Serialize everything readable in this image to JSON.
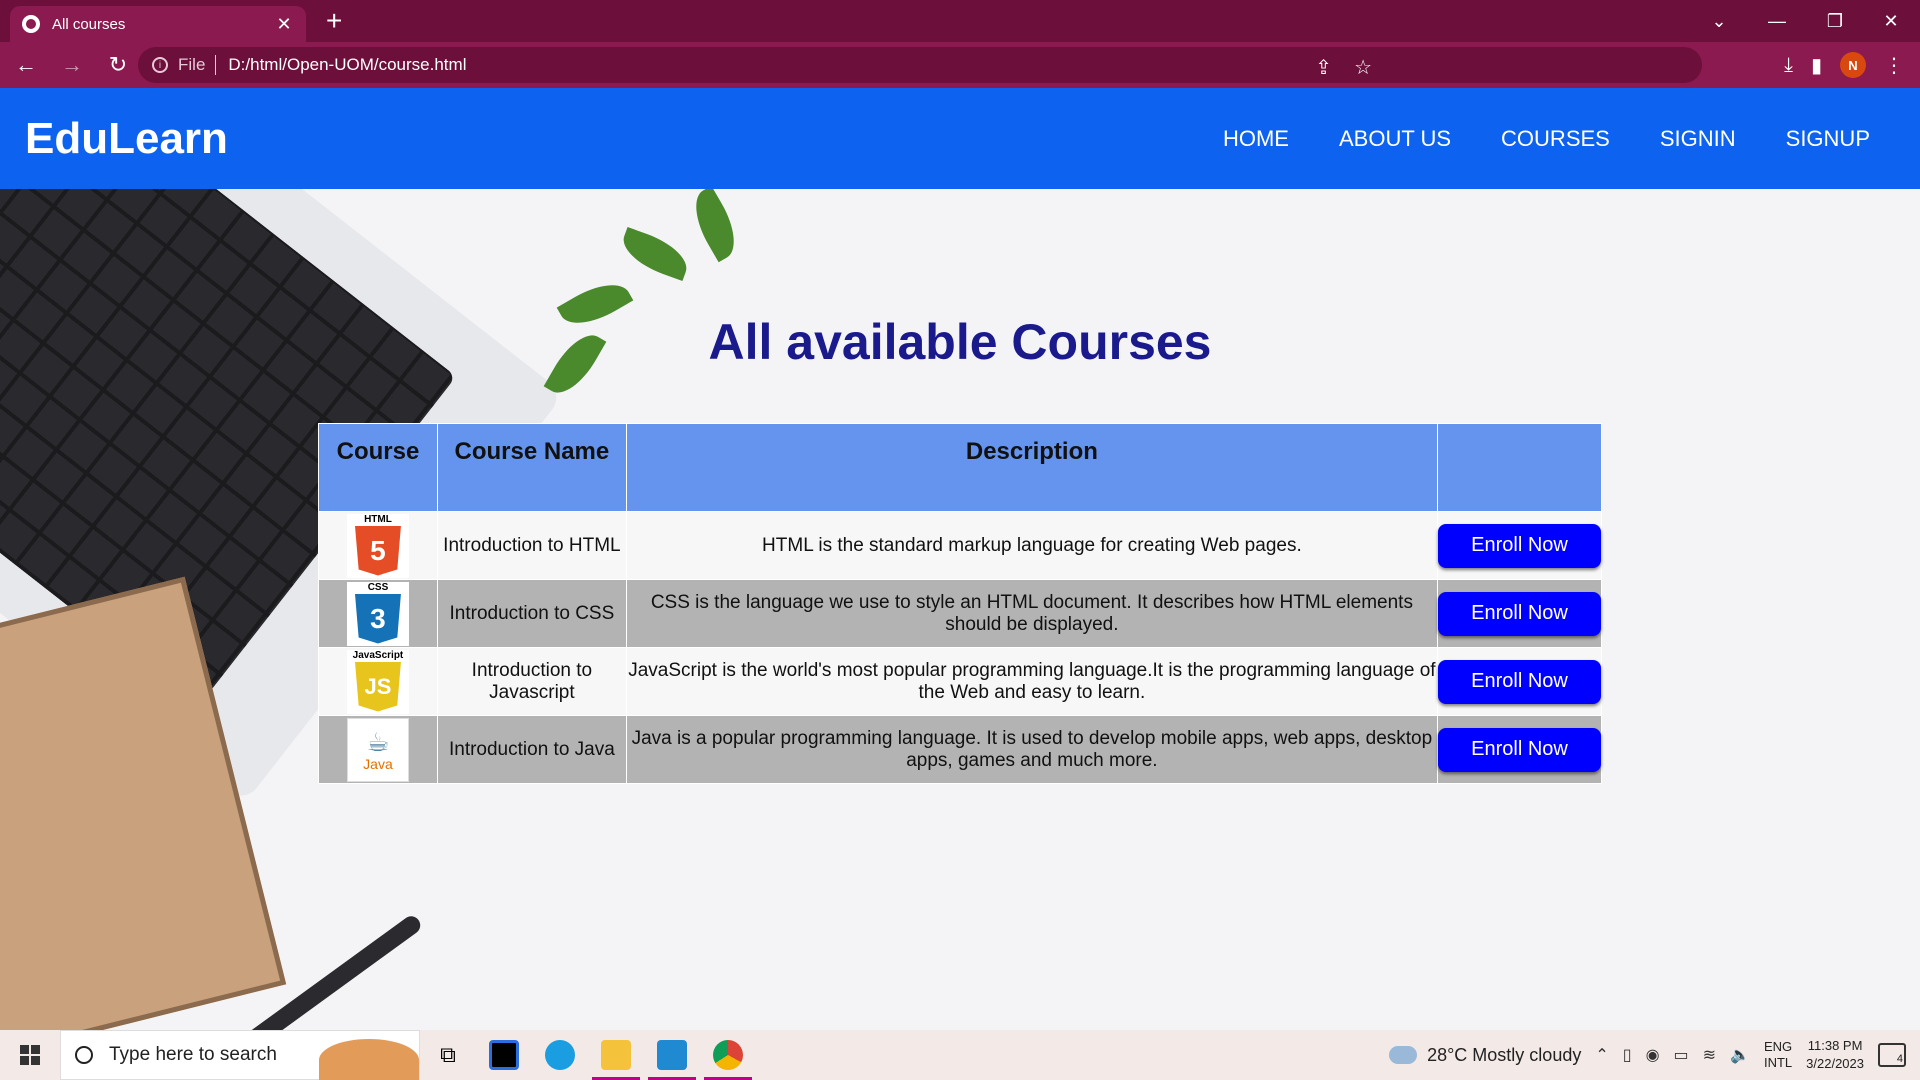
{
  "browser": {
    "tab_title": "All courses",
    "tab_close": "✕",
    "new_tab": "+",
    "file_label": "File",
    "url": "D:/html/Open-UOM/course.html",
    "profile_initial": "N"
  },
  "site": {
    "brand": "EduLearn",
    "menu": [
      "HOME",
      "ABOUT US",
      "COURSES",
      "SIGNIN",
      "SIGNUP"
    ],
    "heading": "All available Courses"
  },
  "table": {
    "headers": [
      "Course",
      "Course Name",
      "Description",
      ""
    ],
    "rows": [
      {
        "logo_tag": "HTML",
        "logo_digit": "5",
        "logo_color": "#e44d26",
        "name": "Introduction to HTML",
        "description": "HTML is the standard markup language for creating Web pages.",
        "action": "Enroll Now"
      },
      {
        "logo_tag": "CSS",
        "logo_digit": "3",
        "logo_color": "#1572b6",
        "name": "Introduction to CSS",
        "description": "CSS is the language we use to style an HTML document. It describes how HTML elements should be displayed.",
        "action": "Enroll Now"
      },
      {
        "logo_tag": "JavaScript",
        "logo_digit": "JS",
        "logo_color": "#e8c51c",
        "name": "Introduction to Javascript",
        "description": "JavaScript is the world's most popular programming language.It is the programming language of the Web and easy to learn.",
        "action": "Enroll Now"
      },
      {
        "logo_tag": "Java",
        "logo_digit": "",
        "logo_color": "#e76f00",
        "name": "Introduction to Java",
        "description": "Java is a popular programming language. It is used to develop mobile apps, web apps, desktop apps, games and much more.",
        "action": "Enroll Now"
      }
    ]
  },
  "taskbar": {
    "search_placeholder": "Type here to search",
    "weather": "28°C  Mostly cloudy",
    "lang_top": "ENG",
    "lang_bottom": "INTL",
    "time": "11:38 PM",
    "date": "3/22/2023",
    "notifications": "4"
  },
  "colors": {
    "navbar": "#0d63f0",
    "heading": "#1a1a8c",
    "table_header": "#6494ed",
    "enroll_button": "#0000ff",
    "browser_frame": "#6c0f3a"
  }
}
